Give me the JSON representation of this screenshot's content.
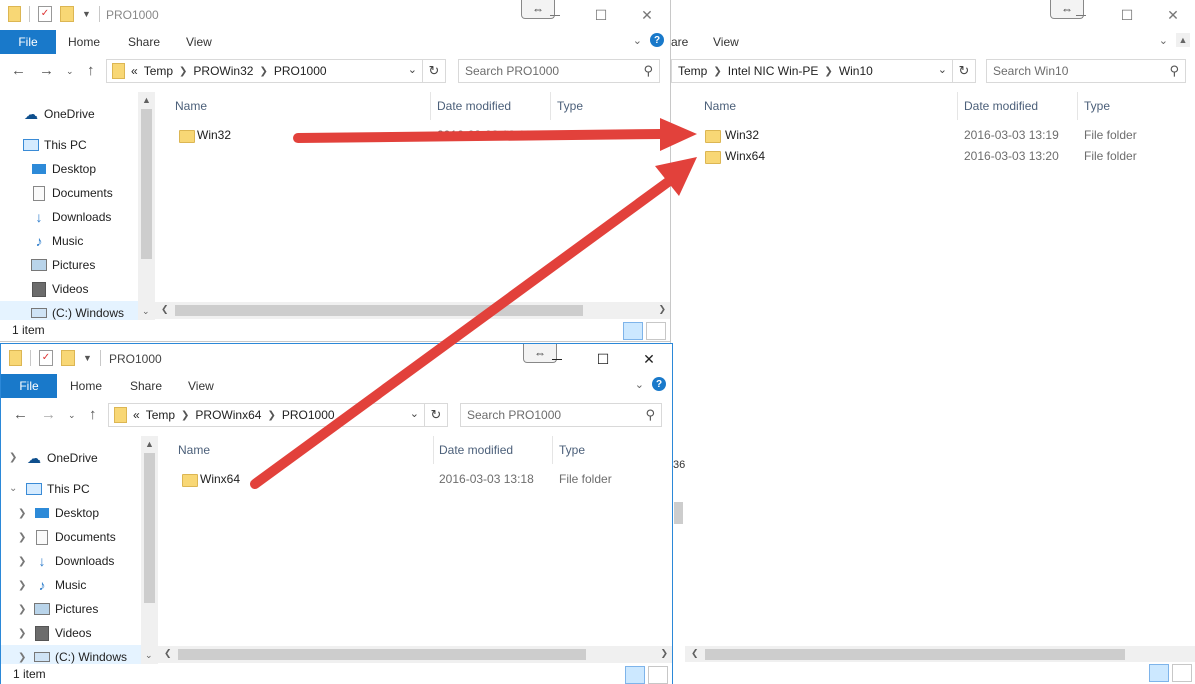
{
  "common": {
    "ribbon_tabs": [
      "File",
      "Home",
      "Share",
      "View"
    ],
    "col_name": "Name",
    "col_date": "Date modified",
    "col_type": "Type",
    "maximize_glyph": "☐",
    "close_glyph": "✕",
    "snap_glyph": "⇔",
    "help_glyph": "?"
  },
  "win_a": {
    "title": "PRO1000",
    "crumbs": [
      "«",
      "Temp",
      "PROWin32",
      "PRO1000"
    ],
    "search_placeholder": "Search PRO1000",
    "nav": [
      "OneDrive",
      "This PC",
      "Desktop",
      "Documents",
      "Downloads",
      "Music",
      "Pictures",
      "Videos",
      "(C:) Windows"
    ],
    "files": [
      {
        "name": "Win32",
        "date": "2016-03-03 13:18",
        "type": "File folder"
      }
    ],
    "status": "1 item"
  },
  "win_b": {
    "title": "",
    "ribbon_tabs": [
      "Share",
      "View"
    ],
    "ribbon_tab_prefix": "are",
    "crumbs": [
      "Temp",
      "Intel NIC Win-PE",
      "Win10"
    ],
    "search_placeholder": "Search Win10",
    "files": [
      {
        "name": "Win32",
        "date": "2016-03-03 13:19",
        "type": "File folder"
      },
      {
        "name": "Winx64",
        "date": "2016-03-03 13:20",
        "type": "File folder"
      }
    ],
    "behind_text": "36"
  },
  "win_c": {
    "title": "PRO1000",
    "crumbs": [
      "«",
      "Temp",
      "PROWinx64",
      "PRO1000"
    ],
    "search_placeholder": "Search PRO1000",
    "nav": [
      "OneDrive",
      "This PC",
      "Desktop",
      "Documents",
      "Downloads",
      "Music",
      "Pictures",
      "Videos",
      "(C:) Windows"
    ],
    "files": [
      {
        "name": "Winx64",
        "date": "2016-03-03 13:18",
        "type": "File folder"
      }
    ],
    "status": "1 item"
  },
  "colors": {
    "accent": "#1979ca",
    "arrow": "#e2413b",
    "folder": "#f8d775",
    "selected_nav": "#e5f3ff"
  }
}
